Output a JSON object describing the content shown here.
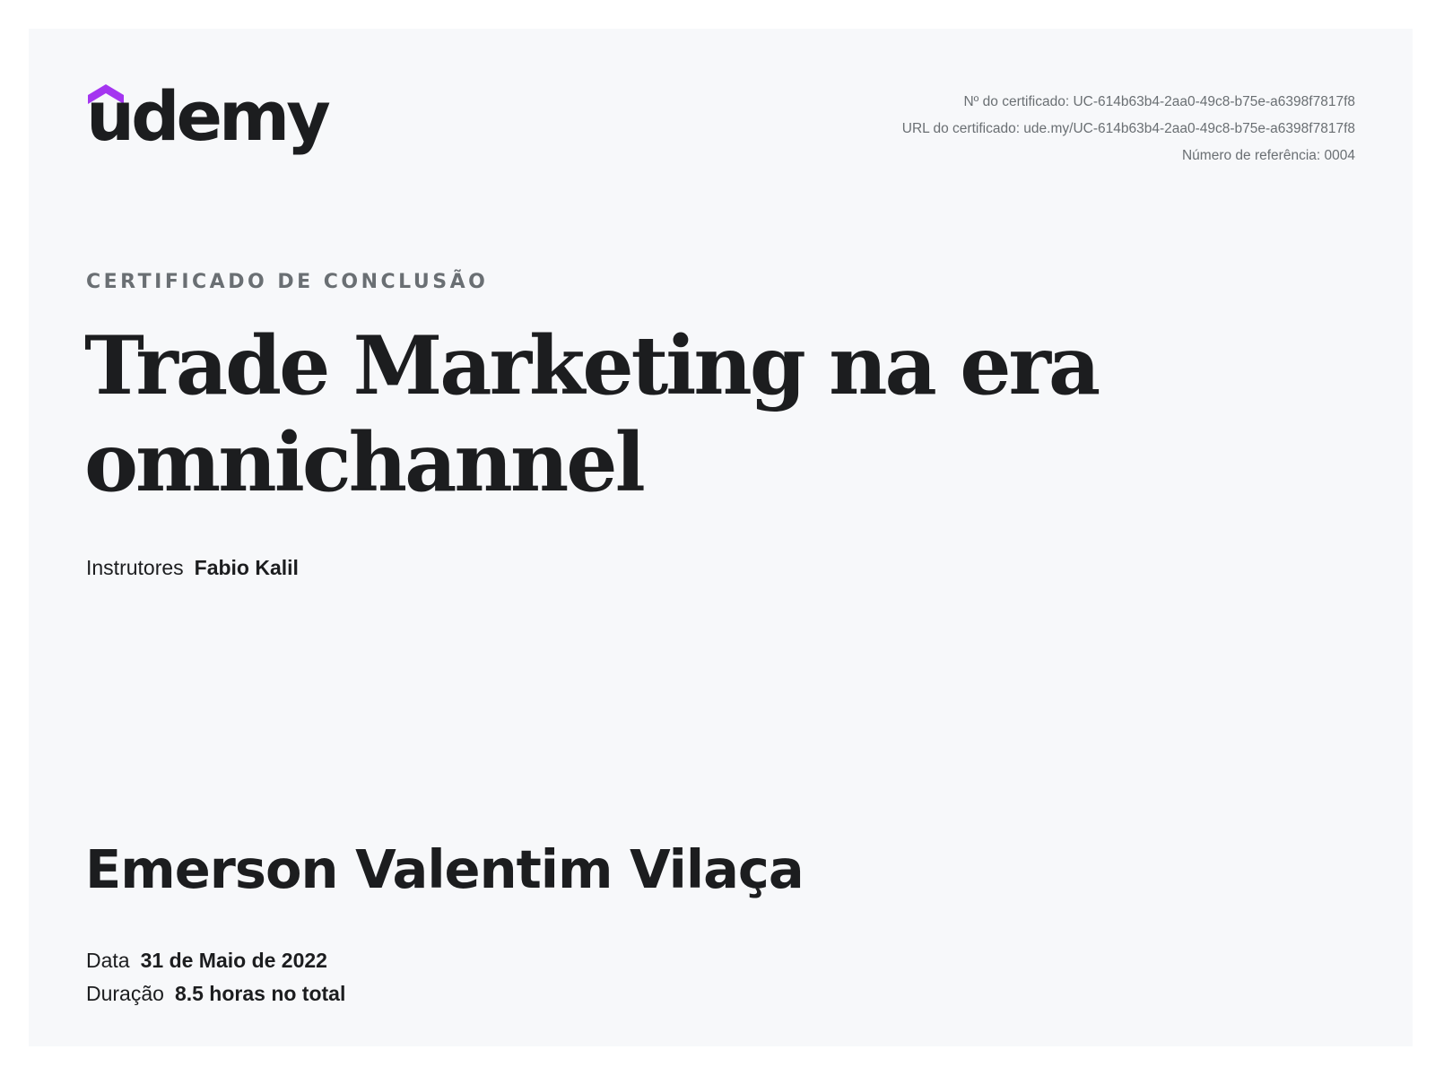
{
  "logo": {
    "text": "udemy",
    "icon": "udemy-hat-icon",
    "accent_color": "#a435f0"
  },
  "meta": {
    "certificate_number": "Nº do certificado: UC-614b63b4-2aa0-49c8-b75e-a6398f7817f8",
    "certificate_url": "URL do certificado: ude.my/UC-614b63b4-2aa0-49c8-b75e-a6398f7817f8",
    "reference_number": "Número de referência: 0004"
  },
  "certificate": {
    "label": "CERTIFICADO DE CONCLUSÃO",
    "course_title": "Trade Marketing na era omnichannel",
    "instructors_label": "Instrutores",
    "instructors_value": "Fabio Kalil",
    "student_name": "Emerson Valentim Vilaça",
    "date_label": "Data",
    "date_value": "31 de Maio de 2022",
    "duration_label": "Duração",
    "duration_value": "8.5 horas no total"
  }
}
